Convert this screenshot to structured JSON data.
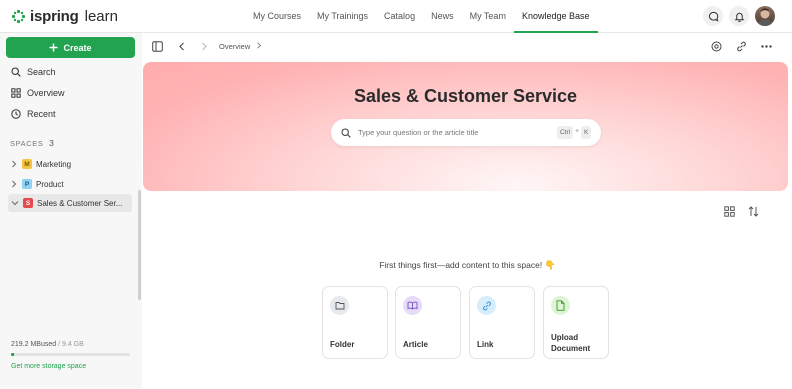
{
  "topbar": {
    "logo_brand": "ispring",
    "logo_product": "learn",
    "nav": [
      {
        "label": "My Courses"
      },
      {
        "label": "My Trainings"
      },
      {
        "label": "Catalog"
      },
      {
        "label": "News"
      },
      {
        "label": "My Team"
      },
      {
        "label": "Knowledge Base",
        "active": true
      }
    ],
    "icons": [
      "chat-icon",
      "bell-icon",
      "user-avatar"
    ]
  },
  "sidebar": {
    "create_label": "Create",
    "items": [
      {
        "label": "Search",
        "icon": "search-icon"
      },
      {
        "label": "Overview",
        "icon": "grid-icon"
      },
      {
        "label": "Recent",
        "icon": "clock-icon"
      }
    ],
    "spaces_title": "SPACES",
    "spaces_count": "3",
    "spaces": [
      {
        "letter": "M",
        "label": "Marketing",
        "color": "#f5c542",
        "text_color": "#7a5a00"
      },
      {
        "letter": "P",
        "label": "Product",
        "color": "#8fd3f0",
        "text_color": "#1e5a7a"
      },
      {
        "letter": "S",
        "label": "Sales & Customer Ser...",
        "color": "#e5484d",
        "text_color": "#ffffff",
        "selected": true
      }
    ],
    "storage_used": "219.2 MB",
    "storage_used_suffix": "used",
    "storage_total": " / 9.4 GB",
    "storage_fraction": 0.023,
    "get_more": "Get more storage space"
  },
  "toolbar": {
    "breadcrumb": "Overview"
  },
  "hero": {
    "title": "Sales & Customer Service",
    "search_placeholder": "Type your question or the article title",
    "kbd_ctrl": "Ctrl",
    "kbd_plus": "+",
    "kbd_k": "K"
  },
  "content": {
    "prompt": "First things first—add content to this space!",
    "prompt_emoji": "👇",
    "cards": [
      {
        "label": "Folder",
        "icon": "folder-icon",
        "color": "#e6e9ee"
      },
      {
        "label": "Article",
        "icon": "book-icon",
        "color": "#e7dcf7"
      },
      {
        "label": "Link",
        "icon": "link-icon",
        "color": "#d6eefc"
      },
      {
        "label_line1": "Upload",
        "label_line2": "Document",
        "icon": "document-icon",
        "color": "#dff3d5"
      }
    ]
  },
  "colors": {
    "accent": "#22a350",
    "hero_pink": "#ffb2b3"
  }
}
